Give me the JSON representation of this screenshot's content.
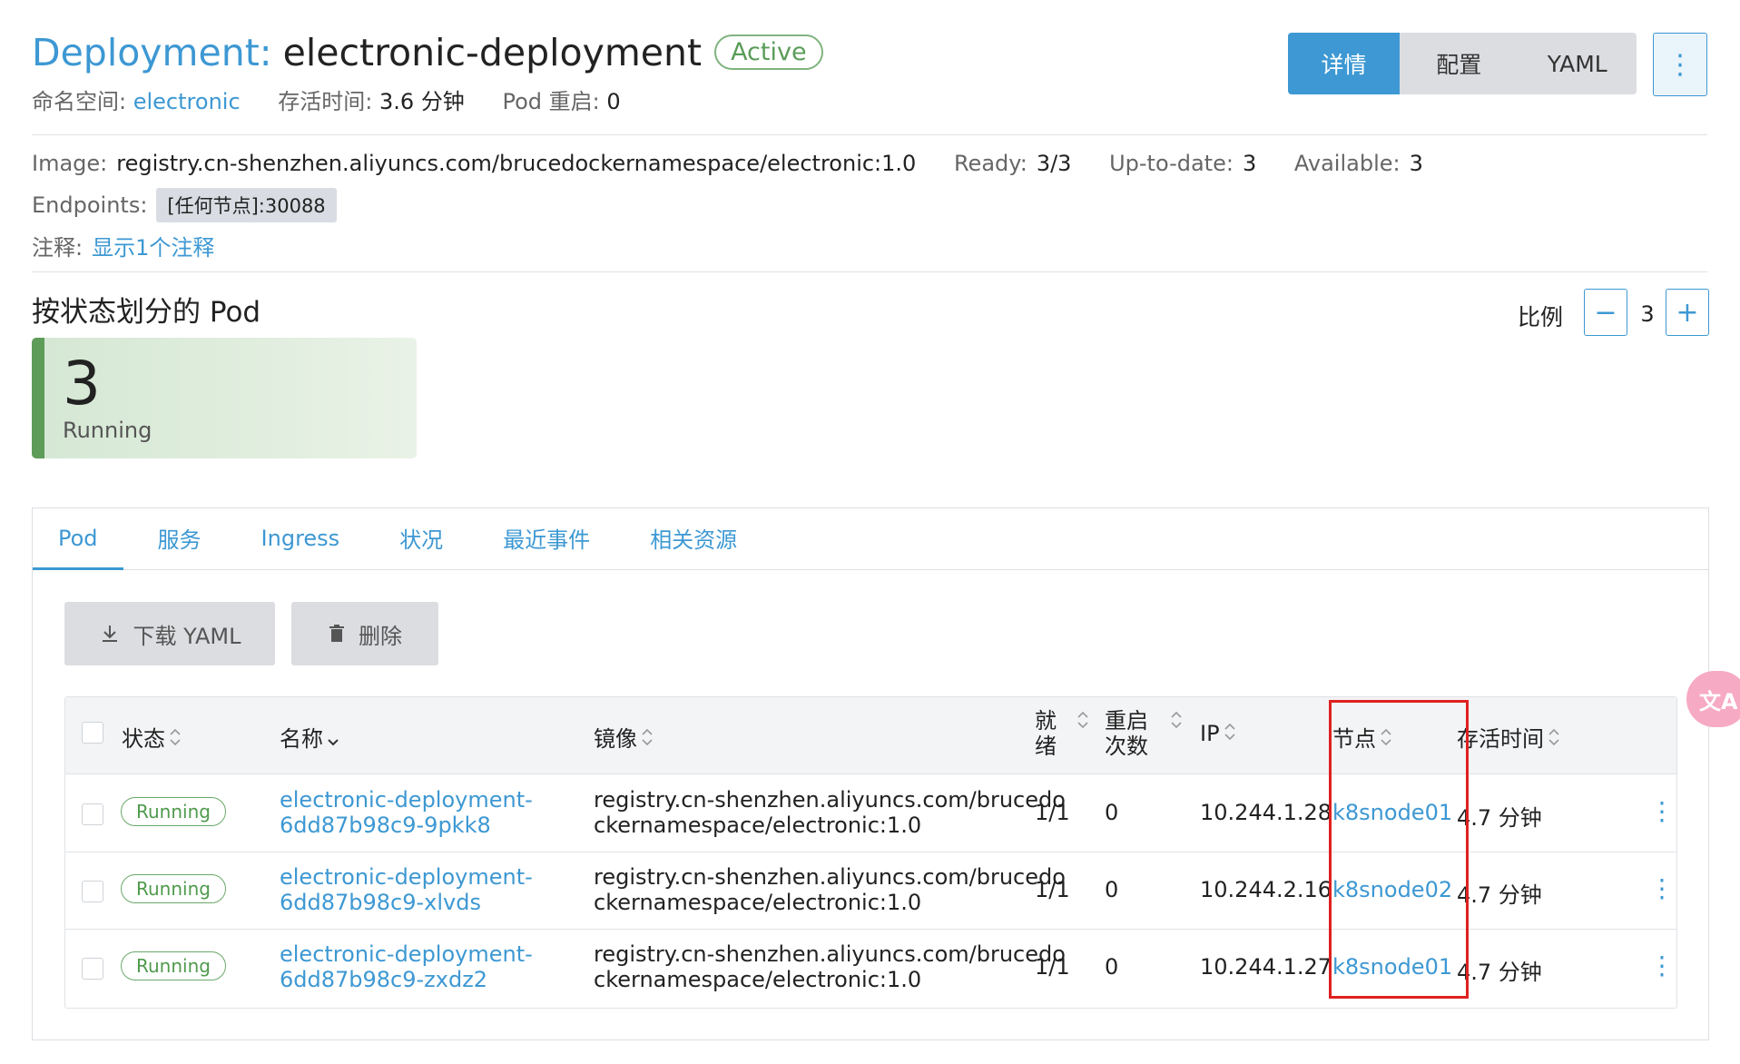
{
  "header": {
    "kind": "Deployment:",
    "name": "electronic-deployment",
    "status": "Active",
    "namespace_label": "命名空间:",
    "namespace_value": "electronic",
    "age_label": "存活时间:",
    "age_value": "3.6 分钟",
    "restarts_label": "Pod 重启:",
    "restarts_value": "0"
  },
  "view_toggle": {
    "items": [
      "详情",
      "配置",
      "YAML"
    ],
    "active": "详情"
  },
  "info": {
    "image_label": "Image:",
    "image_value": "registry.cn-shenzhen.aliyuncs.com/brucedockernamespace/electronic:1.0",
    "ready_label": "Ready:",
    "ready_value": "3/3",
    "uptodate_label": "Up-to-date:",
    "uptodate_value": "3",
    "available_label": "Available:",
    "available_value": "3",
    "endpoints_label": "Endpoints:",
    "endpoints_value": "[任何节点]:30088",
    "annotations_label": "注释:",
    "annotations_link": "显示1个注释"
  },
  "pods_by_state": {
    "title": "按状态划分的 Pod",
    "count": "3",
    "state": "Running"
  },
  "scale": {
    "label": "比例",
    "value": "3",
    "minus": "−",
    "plus": "+"
  },
  "tabs": [
    "Pod",
    "服务",
    "Ingress",
    "状况",
    "最近事件",
    "相关资源"
  ],
  "active_tab": "Pod",
  "actions": {
    "download": "下载 YAML",
    "delete": "删除"
  },
  "table": {
    "columns": {
      "status": "状态",
      "name": "名称",
      "image": "镜像",
      "ready_1": "就",
      "ready_2": "绪",
      "restarts_1": "重启",
      "restarts_2": "次数",
      "ip": "IP",
      "node": "节点",
      "age": "存活时间"
    },
    "rows": [
      {
        "status": "Running",
        "name_1": "electronic-deployment-",
        "name_2": "6dd87b98c9-9pkk8",
        "image_1": "registry.cn-shenzhen.aliyuncs.com/brucedo",
        "image_2": "ckernamespace/electronic:1.0",
        "ready": "1/1",
        "restarts": "0",
        "ip": "10.244.1.28",
        "node": "k8snode01",
        "age": "4.7 分钟"
      },
      {
        "status": "Running",
        "name_1": "electronic-deployment-",
        "name_2": "6dd87b98c9-xlvds",
        "image_1": "registry.cn-shenzhen.aliyuncs.com/brucedo",
        "image_2": "ckernamespace/electronic:1.0",
        "ready": "1/1",
        "restarts": "0",
        "ip": "10.244.2.16",
        "node": "k8snode02",
        "age": "4.7 分钟"
      },
      {
        "status": "Running",
        "name_1": "electronic-deployment-",
        "name_2": "6dd87b98c9-zxdz2",
        "image_1": "registry.cn-shenzhen.aliyuncs.com/brucedo",
        "image_2": "ckernamespace/electronic:1.0",
        "ready": "1/1",
        "restarts": "0",
        "ip": "10.244.1.27",
        "node": "k8snode01",
        "age": "4.7 分钟"
      }
    ]
  },
  "colors": {
    "accent": "#3d98d3",
    "running_green": "#5e9c5a",
    "highlight_red": "#e02020"
  }
}
